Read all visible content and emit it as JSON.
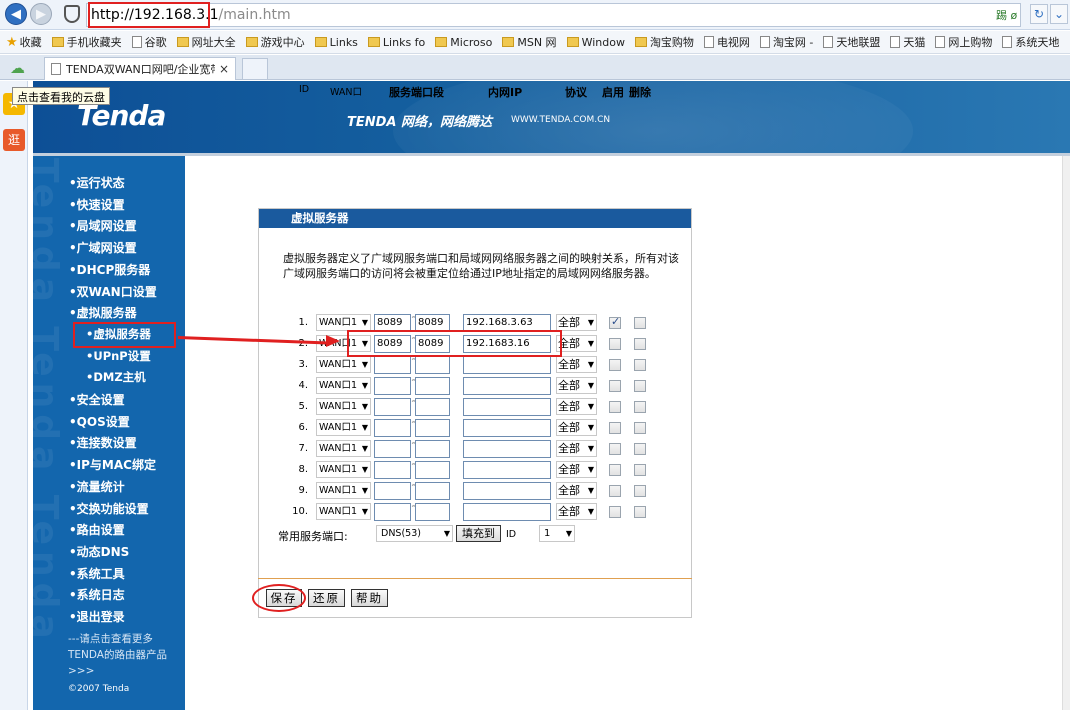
{
  "browser": {
    "url_host": "http://192.168.3.1",
    "url_path": "/main.htm",
    "addr_right": "踢 ø",
    "refresh_icon": "refresh-icon",
    "bookmarks": [
      {
        "label": "收藏",
        "icon": "star-icon"
      },
      {
        "label": "手机收藏夹",
        "icon": "folder-icon"
      },
      {
        "label": "谷歌",
        "icon": "page-icon"
      },
      {
        "label": "网址大全",
        "icon": "folder-icon"
      },
      {
        "label": "游戏中心",
        "icon": "folder-icon"
      },
      {
        "label": "Links",
        "icon": "folder-icon"
      },
      {
        "label": "Links fo",
        "icon": "folder-icon"
      },
      {
        "label": "Microso",
        "icon": "folder-icon"
      },
      {
        "label": "MSN 网",
        "icon": "folder-icon"
      },
      {
        "label": "Window",
        "icon": "folder-icon"
      },
      {
        "label": "淘宝购物",
        "icon": "folder-icon"
      },
      {
        "label": "电视网",
        "icon": "page-icon"
      },
      {
        "label": "淘宝网 -",
        "icon": "page-icon"
      },
      {
        "label": "天地联盟",
        "icon": "page-icon"
      },
      {
        "label": "天猫",
        "icon": "page-icon"
      },
      {
        "label": "网上购物",
        "icon": "page-icon"
      },
      {
        "label": "系统天地",
        "icon": "page-icon"
      }
    ],
    "tab_title": "TENDA双WAN口网吧/企业宽带",
    "tab_close": "×",
    "tooltip": "点击查看我的云盘",
    "strip_bag": "逛"
  },
  "banner": {
    "logo": "Tenda",
    "slogan": "TENDA 网络，网络腾达",
    "site": "WWW.TENDA.COM.CN"
  },
  "menu": {
    "items": [
      {
        "label": "•运行状态",
        "sub": false
      },
      {
        "label": "•快速设置",
        "sub": false
      },
      {
        "label": "•局域网设置",
        "sub": false
      },
      {
        "label": "•广域网设置",
        "sub": false
      },
      {
        "label": "•DHCP服务器",
        "sub": false
      },
      {
        "label": "•双WAN口设置",
        "sub": false
      },
      {
        "label": "•虚拟服务器",
        "sub": false
      },
      {
        "label": "•虚拟服务器",
        "sub": true
      },
      {
        "label": "•UPnP设置",
        "sub": true
      },
      {
        "label": "•DMZ主机",
        "sub": true
      },
      {
        "label": "•安全设置",
        "sub": false
      },
      {
        "label": "•QOS设置",
        "sub": false
      },
      {
        "label": "•连接数设置",
        "sub": false
      },
      {
        "label": "•IP与MAC绑定",
        "sub": false
      },
      {
        "label": "•流量统计",
        "sub": false
      },
      {
        "label": "•交换功能设置",
        "sub": false
      },
      {
        "label": "•路由设置",
        "sub": false
      },
      {
        "label": "•动态DNS",
        "sub": false
      },
      {
        "label": "•系统工具",
        "sub": false
      },
      {
        "label": "•系统日志",
        "sub": false
      },
      {
        "label": "•退出登录",
        "sub": false
      }
    ],
    "footer": "---请点击查看更多TENDA的路由器产品 >>>",
    "copyright": "©2007 Tenda"
  },
  "panel": {
    "title": "虚拟服务器",
    "description": "虚拟服务器定义了广域网服务端口和局域网网络服务器之间的映射关系，所有对该广域网服务端口的访问将会被重定位给通过IP地址指定的局域网网络服务器。",
    "headers": {
      "id": "ID",
      "wan": "WAN口",
      "port": "服务端口段",
      "ip": "内网IP",
      "proto": "协议",
      "enable": "启用",
      "delete": "删除"
    },
    "rows": [
      {
        "id": "1.",
        "wan": "WAN口1",
        "start": "8089",
        "end": "8089",
        "ip": "192.168.3.63",
        "proto": "全部",
        "enabled": true
      },
      {
        "id": "2.",
        "wan": "WAN口1",
        "start": "8089",
        "end": "8089",
        "ip": "192.1683.16",
        "proto": "全部",
        "enabled": false
      },
      {
        "id": "3.",
        "wan": "WAN口1",
        "start": "",
        "end": "",
        "ip": "",
        "proto": "全部",
        "enabled": false
      },
      {
        "id": "4.",
        "wan": "WAN口1",
        "start": "",
        "end": "",
        "ip": "",
        "proto": "全部",
        "enabled": false
      },
      {
        "id": "5.",
        "wan": "WAN口1",
        "start": "",
        "end": "",
        "ip": "",
        "proto": "全部",
        "enabled": false
      },
      {
        "id": "6.",
        "wan": "WAN口1",
        "start": "",
        "end": "",
        "ip": "",
        "proto": "全部",
        "enabled": false
      },
      {
        "id": "7.",
        "wan": "WAN口1",
        "start": "",
        "end": "",
        "ip": "",
        "proto": "全部",
        "enabled": false
      },
      {
        "id": "8.",
        "wan": "WAN口1",
        "start": "",
        "end": "",
        "ip": "",
        "proto": "全部",
        "enabled": false
      },
      {
        "id": "9.",
        "wan": "WAN口1",
        "start": "",
        "end": "",
        "ip": "",
        "proto": "全部",
        "enabled": false
      },
      {
        "id": "10.",
        "wan": "WAN口1",
        "start": "",
        "end": "",
        "ip": "",
        "proto": "全部",
        "enabled": false
      }
    ],
    "common_label": "常用服务端口:",
    "common_value": "DNS(53)",
    "fill_button": "填充到",
    "id_label": "ID",
    "id_value": "1",
    "save": "保存",
    "restore": "还原",
    "help": "帮助"
  },
  "accent": {
    "annotation_red": "#e02020",
    "menu_blue": "#1366ad"
  }
}
